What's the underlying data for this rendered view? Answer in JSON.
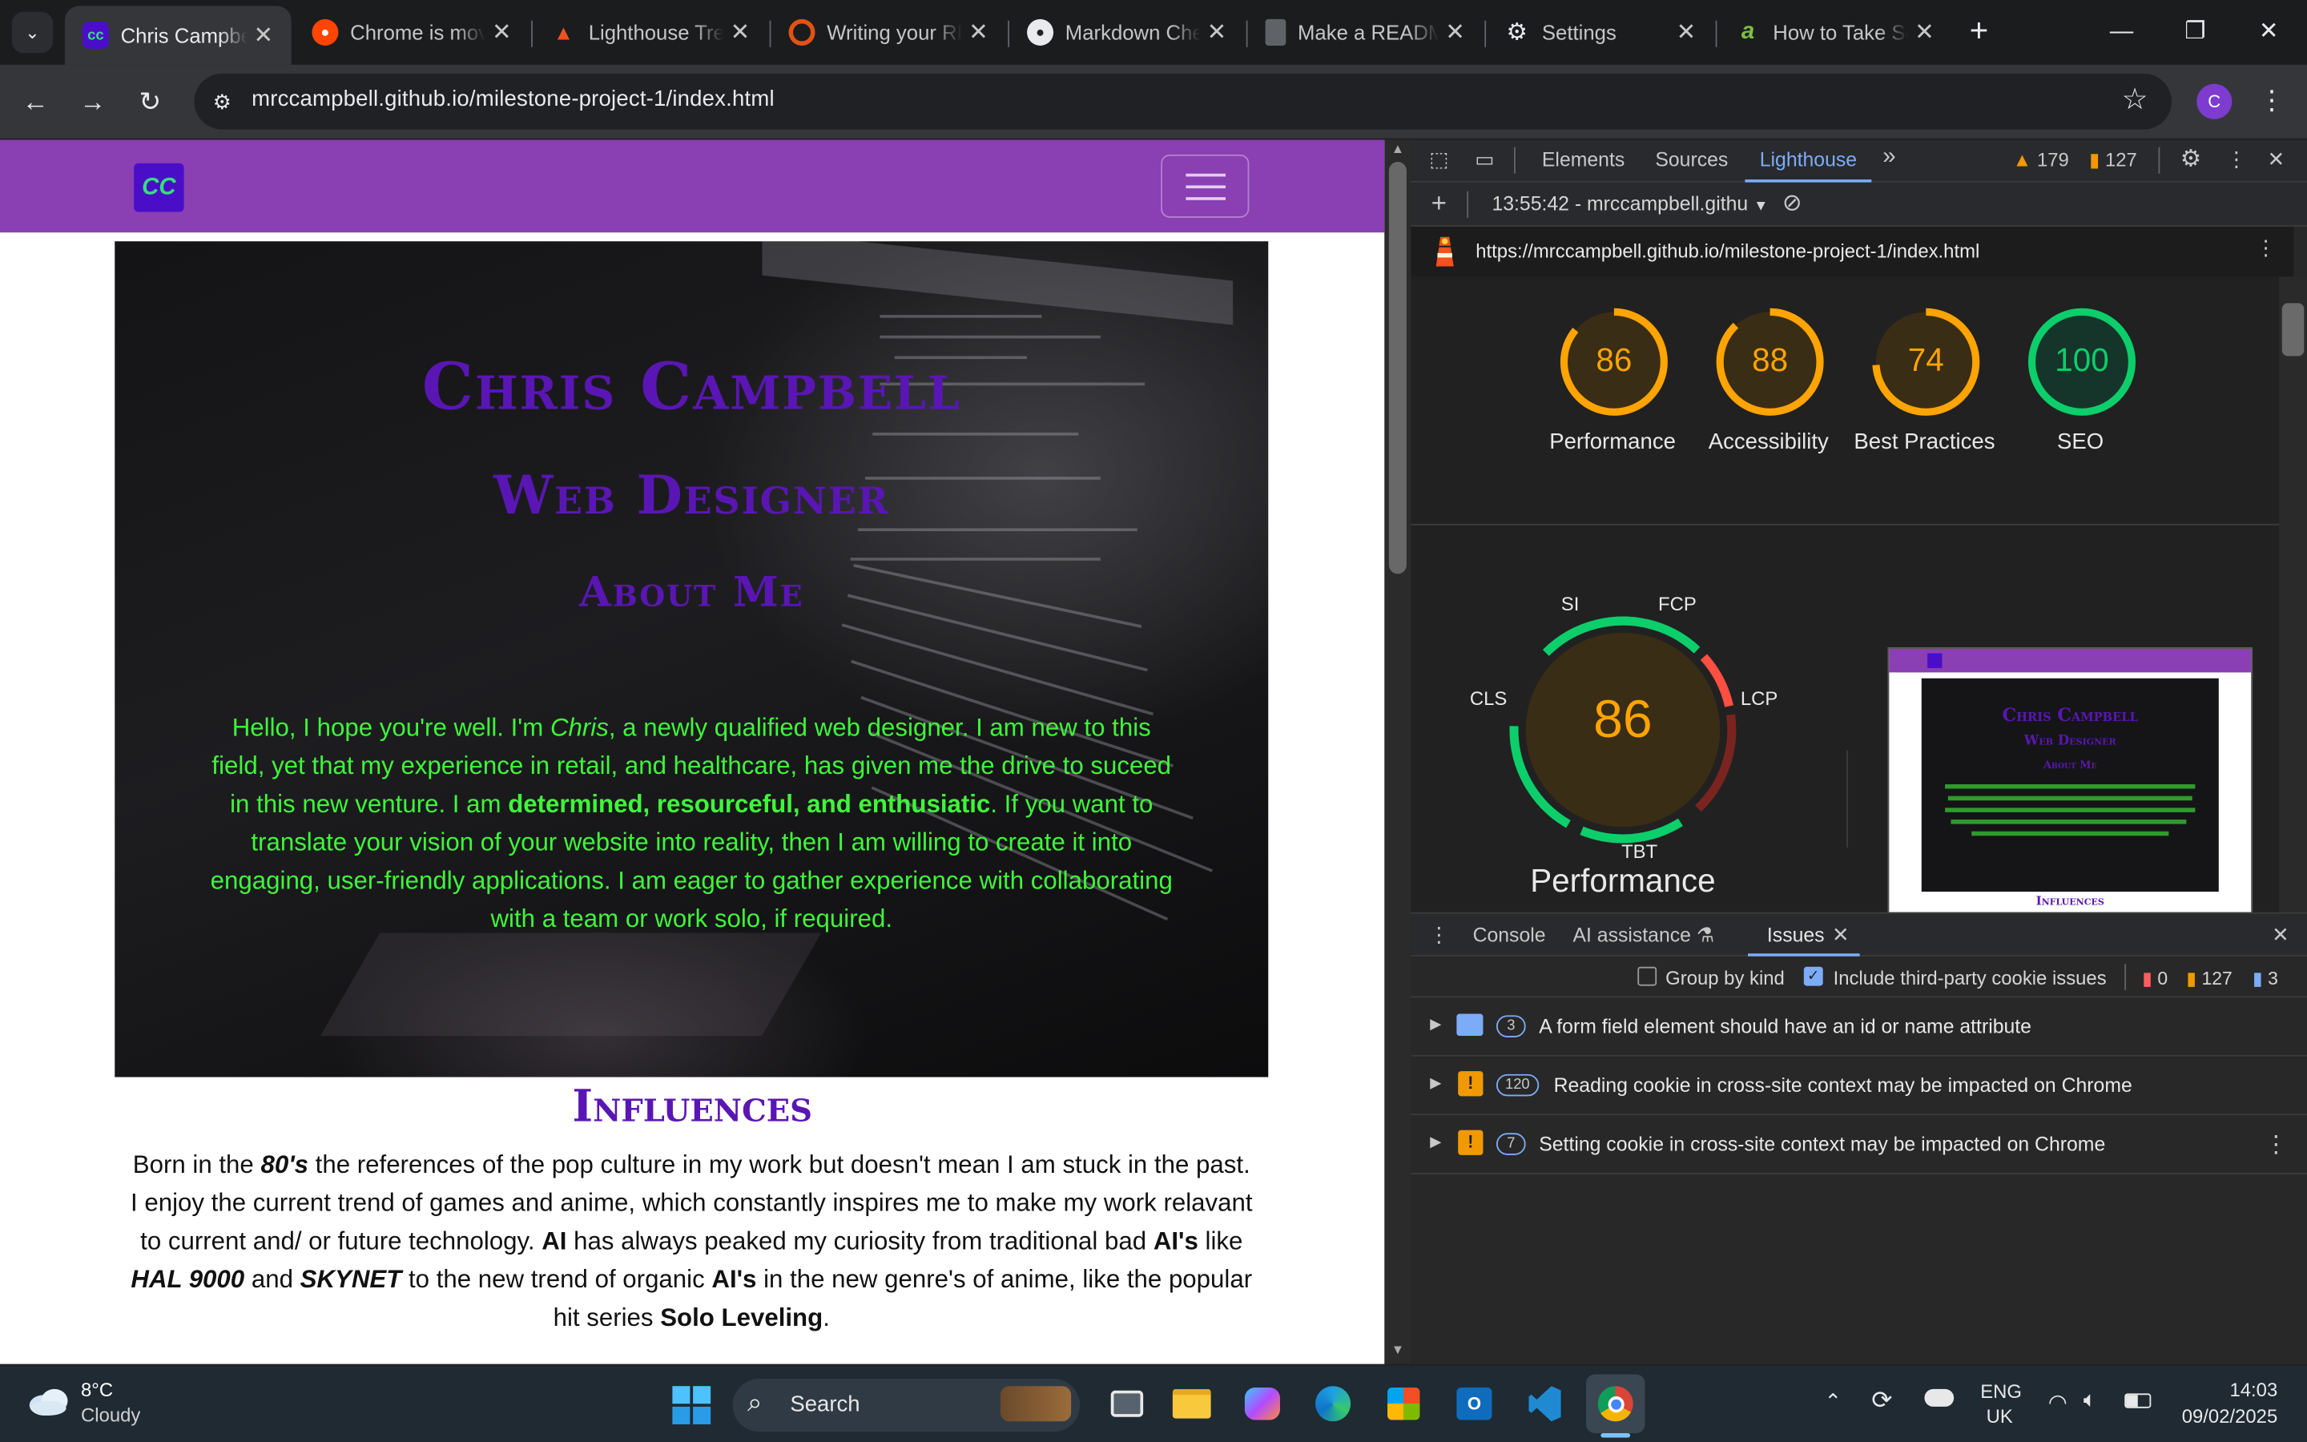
{
  "browser": {
    "tabs": [
      {
        "title": "Chris Campbell",
        "favicon": "cc-icon",
        "color": "#4a0ec9",
        "active": true
      },
      {
        "title": "Chrome is moving",
        "favicon": "reddit-icon",
        "color": "#ff4500"
      },
      {
        "title": "Lighthouse Tree",
        "favicon": "lighthouse-icon",
        "color": "#f4511e"
      },
      {
        "title": "Writing your README",
        "favicon": "codeinstitute-icon",
        "color": "#e25215"
      },
      {
        "title": "Markdown Cheatsheet",
        "favicon": "github-icon",
        "color": "#e8eaed"
      },
      {
        "title": "Make a README",
        "favicon": "document-icon",
        "color": "#5f6368"
      },
      {
        "title": "Settings",
        "favicon": "gear-icon",
        "color": "#e8eaed"
      },
      {
        "title": "How to Take Screenshots",
        "favicon": "a-icon",
        "color": "#7bc043"
      }
    ],
    "url": "mrccampbell.github.io/milestone-project-1/index.html",
    "profile_initial": "C"
  },
  "site": {
    "brand": "CC",
    "hero_name": "Chris Campbell",
    "hero_role": "Web Designer",
    "hero_about_title": "About Me",
    "about": {
      "p1": "Hello, I hope you're well. I'm ",
      "name": "Chris",
      "p2": ", a newly qualified web designer. I am new to this field, yet that my experience in retail, and healthcare, has given me the drive to suceed in this new venture. I am ",
      "traits": "determined, resourceful, and enthusiatic",
      "p3": ". If you want to translate your vision of your website into reality, then I am willing to create it into engaging, user-friendly applications. I am eager to gather experience with collaborating with a team or work solo, if required."
    },
    "influences_title": "Influences",
    "influences": {
      "t1": "Born in the ",
      "eighties": "80's",
      "t2": " the references of the pop culture in my work but doesn't mean I am stuck in the past. I enjoy the current trend of games and anime, which constantly inspires me to make my work relavant to current and/ or future technology. ",
      "ai1": "AI",
      "t3": " has always peaked my curiosity from traditional bad ",
      "ai2": "AI's",
      "t4": " like ",
      "hal": "HAL 9000",
      "t5": " and ",
      "skynet": "SKYNET",
      "t6": " to the new trend of organic ",
      "ai3": "AI's",
      "t7": " in the new genre's of anime, like the popular hit series ",
      "solo": "Solo Leveling",
      "t8": "."
    }
  },
  "devtools": {
    "tabs": [
      "Elements",
      "Sources",
      "Lighthouse"
    ],
    "warning_count": "179",
    "error_count": "127",
    "report_select": "13:55:42 - mrccampbell.githu",
    "report_url": "https://mrccampbell.github.io/milestone-project-1/index.html",
    "scores": [
      {
        "label": "Performance",
        "value": 86,
        "color": "#ffa400"
      },
      {
        "label": "Accessibility",
        "value": 88,
        "color": "#ffa400"
      },
      {
        "label": "Best Practices",
        "value": 74,
        "color": "#ffa400"
      },
      {
        "label": "SEO",
        "value": 100,
        "color": "#0cce6b"
      }
    ],
    "perf_gauge": {
      "score": "86",
      "title": "Performance",
      "metrics": [
        "SI",
        "FCP",
        "LCP",
        "TBT",
        "CLS"
      ]
    },
    "thumb": {
      "name": "Chris Campbell",
      "role": "Web Designer",
      "about": "About Me",
      "influences": "Influences"
    },
    "drawer_tabs": [
      "Console",
      "AI assistance",
      "Issues"
    ],
    "issues_options": {
      "group_by_kind": "Group by kind",
      "include_third_party": "Include third-party cookie issues",
      "counts": [
        "0",
        "127",
        "3"
      ]
    },
    "issues": [
      {
        "count": "3",
        "text": "A form field element should have an id or name attribute",
        "kind": "info"
      },
      {
        "count": "120",
        "text": "Reading cookie in cross-site context may be impacted on Chrome",
        "kind": "warning"
      },
      {
        "count": "7",
        "text": "Setting cookie in cross-site context may be impacted on Chrome",
        "kind": "warning"
      }
    ]
  },
  "taskbar": {
    "weather_temp": "8°C",
    "weather_desc": "Cloudy",
    "search_placeholder": "Search",
    "lang": "ENG",
    "region": "UK",
    "time": "14:03",
    "date": "09/02/2025"
  }
}
